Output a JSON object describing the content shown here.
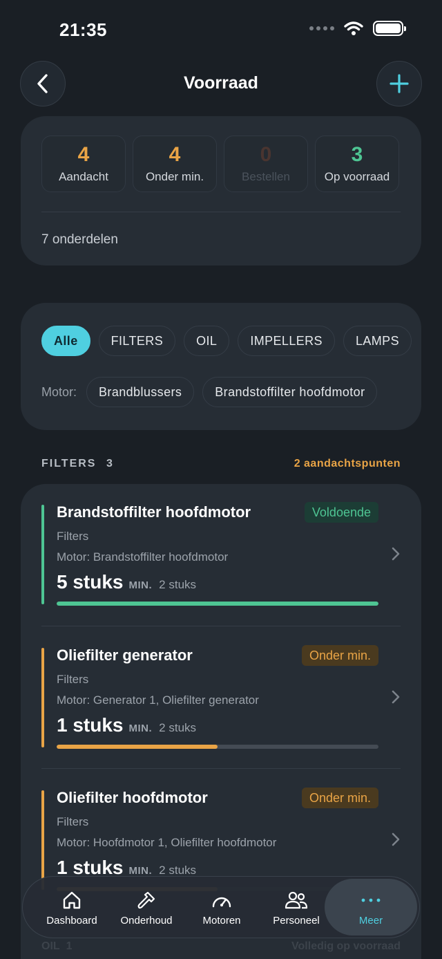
{
  "status_bar": {
    "time": "21:35"
  },
  "header": {
    "title": "Voorraad",
    "back_icon": "chevron-left-icon",
    "add_icon": "plus-icon"
  },
  "summary": {
    "stats": [
      {
        "value": "4",
        "label": "Aandacht",
        "color": "#e9a446"
      },
      {
        "value": "4",
        "label": "Onder min.",
        "color": "#e9a446"
      },
      {
        "value": "0",
        "label": "Bestellen",
        "color": "#4a3530"
      },
      {
        "value": "3",
        "label": "Op voorraad",
        "color": "#4ec593"
      }
    ],
    "parts_count": "7 onderdelen"
  },
  "filters": {
    "categories": [
      "Alle",
      "FILTERS",
      "OIL",
      "IMPELLERS",
      "LAMPS"
    ],
    "selected": "Alle",
    "motor_label": "Motor:",
    "motors": [
      "Brandblussers",
      "Brandstoffilter hoofdmotor"
    ]
  },
  "section": {
    "title": "FILTERS",
    "count": "3",
    "alert": "2 aandachtspunten"
  },
  "items": [
    {
      "name": "Brandstoffilter hoofdmotor",
      "badge": "Voldoende",
      "status": "ok",
      "category": "Filters",
      "motor": "Motor: Brandstoffilter hoofdmotor",
      "qty": "5 stuks",
      "min_label": "MIN.",
      "min": "2 stuks",
      "level": 1.0,
      "color": "#4ec593"
    },
    {
      "name": "Oliefilter generator",
      "badge": "Onder min.",
      "status": "warn",
      "category": "Filters",
      "motor": "Motor: Generator 1, Oliefilter generator",
      "qty": "1 stuks",
      "min_label": "MIN.",
      "min": "2 stuks",
      "level": 0.5,
      "color": "#e9a446"
    },
    {
      "name": "Oliefilter hoofdmotor",
      "badge": "Onder min.",
      "status": "warn",
      "category": "Filters",
      "motor": "Motor: Hoofdmotor 1, Oliefilter hoofdmotor",
      "qty": "1 stuks",
      "min_label": "MIN.",
      "min": "2 stuks",
      "level": 0.5,
      "color": "#e9a446"
    }
  ],
  "next_section": {
    "title": "OIL",
    "count": "1",
    "note": "Volledig op voorraad"
  },
  "tabs": [
    {
      "label": "Dashboard",
      "icon": "home-icon"
    },
    {
      "label": "Onderhoud",
      "icon": "wrench-icon"
    },
    {
      "label": "Motoren",
      "icon": "gauge-icon"
    },
    {
      "label": "Personeel",
      "icon": "people-icon"
    },
    {
      "label": "Meer",
      "icon": "more-icon",
      "active": true
    }
  ],
  "colors": {
    "accent": "#4fcfe0",
    "warning": "#e9a446",
    "success": "#4ec593",
    "background": "#1a1f25",
    "card": "#262d35"
  }
}
